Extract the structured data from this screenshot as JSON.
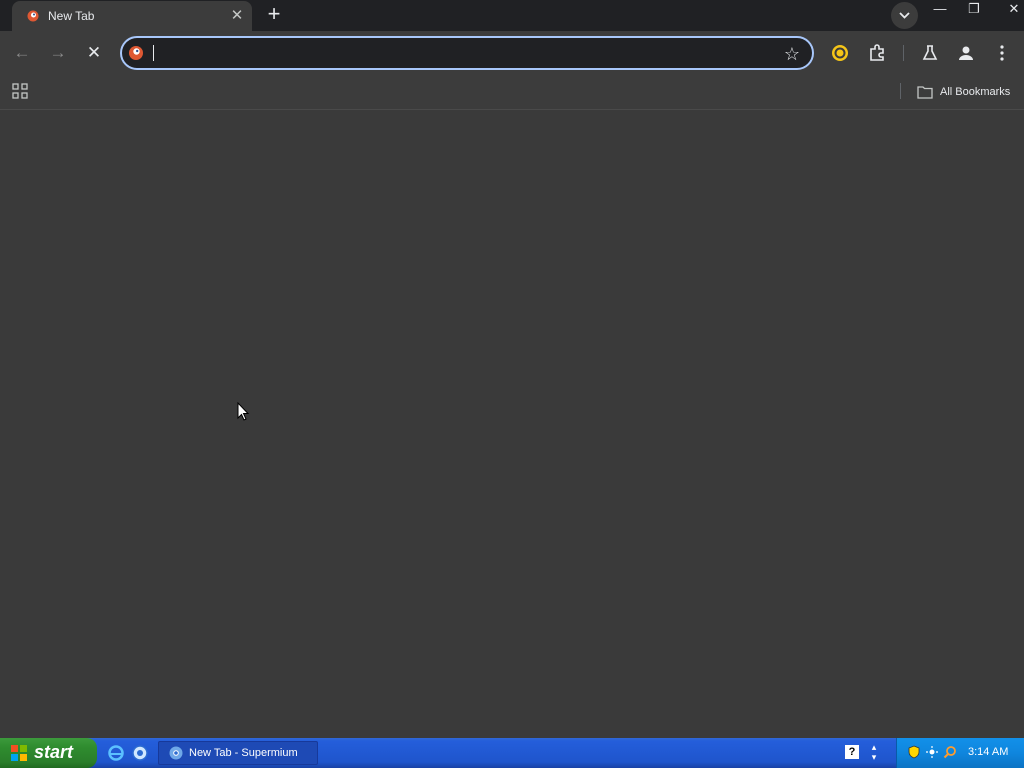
{
  "browser": {
    "tab": {
      "title": "New Tab",
      "close_label": "✕"
    },
    "new_tab_label": "+",
    "window_controls": {
      "minimize": "—",
      "restore": "❐",
      "close": "✕"
    },
    "nav": {
      "back": "←",
      "forward": "→",
      "stop": "✕"
    },
    "omnibox": {
      "value": "",
      "placeholder": ""
    },
    "bookmarks_bar": {
      "all_bookmarks": "All Bookmarks"
    }
  },
  "taskbar": {
    "start_label": "start",
    "task_item": "New Tab - Supermium",
    "help_icon": "?",
    "clock": "3:14 AM"
  },
  "colors": {
    "tabstrip": "#202124",
    "toolbar": "#3c3c3c",
    "content": "#3a3a3a",
    "omnibox_focus": "#a8c7fa",
    "taskbar_blue": "#245edb",
    "start_green": "#2f8c2f"
  }
}
